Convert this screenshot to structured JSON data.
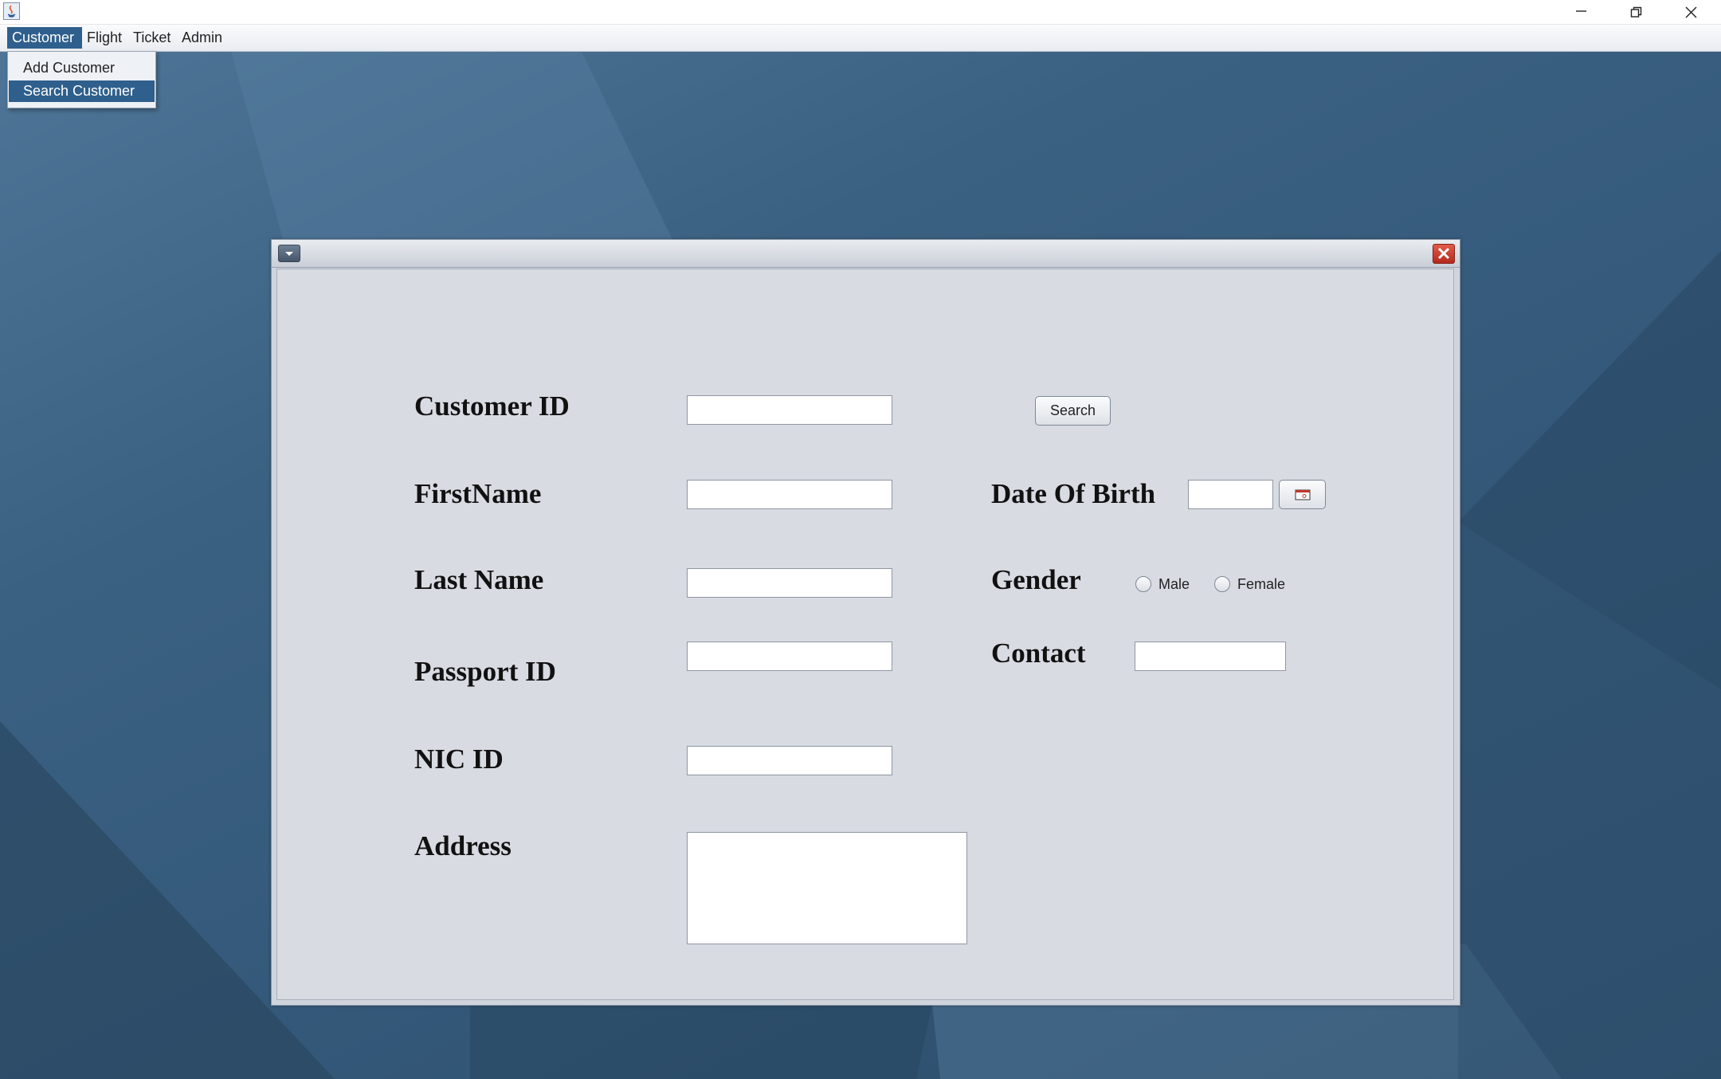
{
  "menubar": {
    "items": [
      {
        "label": "Customer"
      },
      {
        "label": "Flight"
      },
      {
        "label": "Ticket"
      },
      {
        "label": "Admin"
      }
    ]
  },
  "customer_menu": {
    "items": [
      {
        "label": "Add Customer"
      },
      {
        "label": "Search Customer"
      }
    ]
  },
  "form": {
    "customer_id": {
      "label": "Customer ID",
      "value": ""
    },
    "search_button": "Search",
    "first_name": {
      "label": "FirstName",
      "value": ""
    },
    "last_name": {
      "label": "Last Name",
      "value": ""
    },
    "passport_id": {
      "label": "Passport ID",
      "value": ""
    },
    "nic_id": {
      "label": "NIC ID",
      "value": ""
    },
    "address": {
      "label": "Address",
      "value": ""
    },
    "date_of_birth": {
      "label": "Date Of Birth",
      "value": ""
    },
    "gender": {
      "label": "Gender",
      "options": [
        "Male",
        "Female"
      ]
    },
    "contact": {
      "label": "Contact",
      "value": ""
    }
  },
  "colors": {
    "menu_highlight": "#2f5f8c",
    "desktop": "#3b6182",
    "close_button": "#c0392b"
  }
}
